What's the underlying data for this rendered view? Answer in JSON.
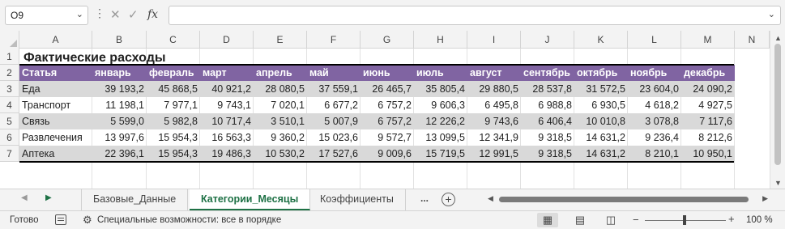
{
  "formula_bar": {
    "name_box": "O9",
    "formula": "",
    "fx_label": "fx"
  },
  "columns": [
    "A",
    "B",
    "C",
    "D",
    "E",
    "F",
    "G",
    "H",
    "I",
    "J",
    "K",
    "L",
    "M",
    "N"
  ],
  "rows": [
    "1",
    "2",
    "3",
    "4",
    "5",
    "6",
    "7"
  ],
  "sheet": {
    "title": "Фактические расходы",
    "headers": [
      "Статья",
      "январь",
      "февраль",
      "март",
      "апрель",
      "май",
      "июнь",
      "июль",
      "август",
      "сентябрь",
      "октябрь",
      "ноябрь",
      "декабрь"
    ],
    "data": [
      [
        "Еда",
        "39 193,2",
        "45 868,5",
        "40 921,2",
        "28 080,5",
        "37 559,1",
        "26 465,7",
        "35 805,4",
        "29 880,5",
        "28 537,8",
        "31 572,5",
        "23 604,0",
        "24 090,2"
      ],
      [
        "Транспорт",
        "11 198,1",
        "7 977,1",
        "9 743,1",
        "7 020,1",
        "6 677,2",
        "6 757,2",
        "9 606,3",
        "6 495,8",
        "6 988,8",
        "6 930,5",
        "4 618,2",
        "4 927,5"
      ],
      [
        "Связь",
        "5 599,0",
        "5 982,8",
        "10 717,4",
        "3 510,1",
        "5 007,9",
        "6 757,2",
        "12 226,2",
        "9 743,6",
        "6 406,4",
        "10 010,8",
        "3 078,8",
        "7 117,6"
      ],
      [
        "Развлечения",
        "13 997,6",
        "15 954,3",
        "16 563,3",
        "9 360,2",
        "15 023,6",
        "9 572,7",
        "13 099,5",
        "12 341,9",
        "9 318,5",
        "14 631,2",
        "9 236,4",
        "8 212,6"
      ],
      [
        "Аптека",
        "22 396,1",
        "15 954,3",
        "19 486,3",
        "10 530,2",
        "17 527,6",
        "9 009,6",
        "15 719,5",
        "12 991,5",
        "9 318,5",
        "14 631,2",
        "8 210,1",
        "10 950,1"
      ]
    ]
  },
  "tabs": [
    "Базовые_Данные",
    "Категории_Месяцы",
    "Коэффициенты"
  ],
  "active_tab": "Категории_Месяцы",
  "tabs_more": "...",
  "status": {
    "ready": "Готово",
    "accessibility": "Специальные возможности: все в порядке",
    "zoom": "100 %"
  },
  "colors": {
    "header_fill": "#8064a2",
    "grey_row": "#d9d9d9",
    "active_tab": "#1e7145"
  }
}
